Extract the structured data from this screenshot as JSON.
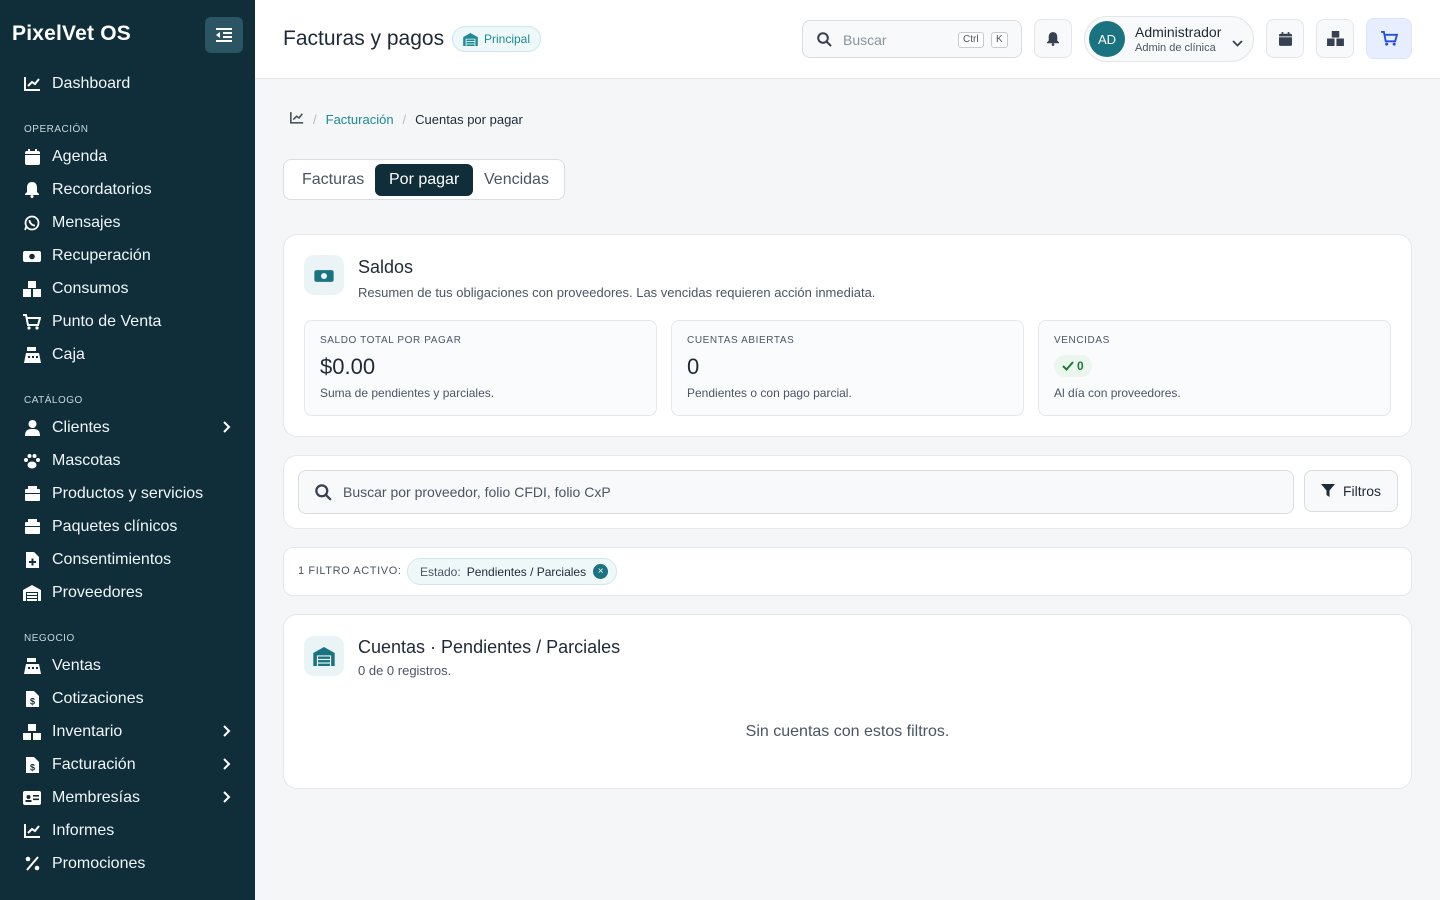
{
  "app": {
    "brand": "PixelVet OS"
  },
  "sidebar": {
    "top_item": {
      "label": "Dashboard",
      "icon": "chart-line-icon"
    },
    "sections": [
      {
        "title": "OPERACIÓN",
        "items": [
          {
            "label": "Agenda",
            "icon": "calendar-icon"
          },
          {
            "label": "Recordatorios",
            "icon": "bell-icon"
          },
          {
            "label": "Mensajes",
            "icon": "whatsapp-icon"
          },
          {
            "label": "Recuperación",
            "icon": "money-icon"
          },
          {
            "label": "Consumos",
            "icon": "boxes-icon"
          },
          {
            "label": "Punto de Venta",
            "icon": "cart-icon"
          },
          {
            "label": "Caja",
            "icon": "cash-register-icon"
          }
        ]
      },
      {
        "title": "CATÁLOGO",
        "items": [
          {
            "label": "Clientes",
            "icon": "user-icon",
            "expandable": true
          },
          {
            "label": "Mascotas",
            "icon": "paw-icon"
          },
          {
            "label": "Productos y servicios",
            "icon": "box-icon"
          },
          {
            "label": "Paquetes clínicos",
            "icon": "box-icon"
          },
          {
            "label": "Consentimientos",
            "icon": "file-plus-icon"
          },
          {
            "label": "Proveedores",
            "icon": "warehouse-icon"
          }
        ]
      },
      {
        "title": "NEGOCIO",
        "items": [
          {
            "label": "Ventas",
            "icon": "cash-register-icon"
          },
          {
            "label": "Cotizaciones",
            "icon": "file-invoice-icon"
          },
          {
            "label": "Inventario",
            "icon": "cubes-icon",
            "expandable": true
          },
          {
            "label": "Facturación",
            "icon": "file-invoice-icon",
            "expandable": true
          },
          {
            "label": "Membresías",
            "icon": "id-card-icon",
            "expandable": true
          },
          {
            "label": "Informes",
            "icon": "chart-line-icon"
          },
          {
            "label": "Promociones",
            "icon": "percent-icon"
          }
        ]
      }
    ]
  },
  "header": {
    "title": "Facturas y pagos",
    "branch_badge": "Principal",
    "search": {
      "placeholder": "Buscar",
      "kbd_ctrl": "Ctrl",
      "kbd_k": "K"
    },
    "user": {
      "initials": "AD",
      "name": "Administrador",
      "role": "Admin de clínica"
    }
  },
  "breadcrumb": {
    "link": "Facturación",
    "current": "Cuentas por pagar"
  },
  "tabs": [
    {
      "label": "Facturas",
      "active": false
    },
    {
      "label": "Por pagar",
      "active": true
    },
    {
      "label": "Vencidas",
      "active": false
    }
  ],
  "saldos": {
    "title": "Saldos",
    "subtitle": "Resumen de tus obligaciones con proveedores. Las vencidas requieren acción inmediata.",
    "stats": [
      {
        "label": "SALDO TOTAL POR PAGAR",
        "value": "$0.00",
        "note": "Suma de pendientes y parciales."
      },
      {
        "label": "CUENTAS ABIERTAS",
        "value": "0",
        "note": "Pendientes o con pago parcial."
      },
      {
        "label": "VENCIDAS",
        "value": "0",
        "note": "Al día con proveedores."
      }
    ]
  },
  "filters": {
    "search_placeholder": "Buscar por proveedor, folio CFDI, folio CxP",
    "button_label": "Filtros",
    "active_label": "1 FILTRO ACTIVO:",
    "chip": {
      "key": "Estado:",
      "value": "Pendientes / Parciales",
      "remove": "×"
    }
  },
  "accounts": {
    "title": "Cuentas · Pendientes / Parciales",
    "count": "0 de 0 registros.",
    "empty": "Sin cuentas con estos filtros."
  },
  "colors": {
    "sidebar": "#0f2e3a",
    "accent": "#1e8a96",
    "active_tab": "#0f2e3a",
    "success": "#1e7a3c"
  }
}
